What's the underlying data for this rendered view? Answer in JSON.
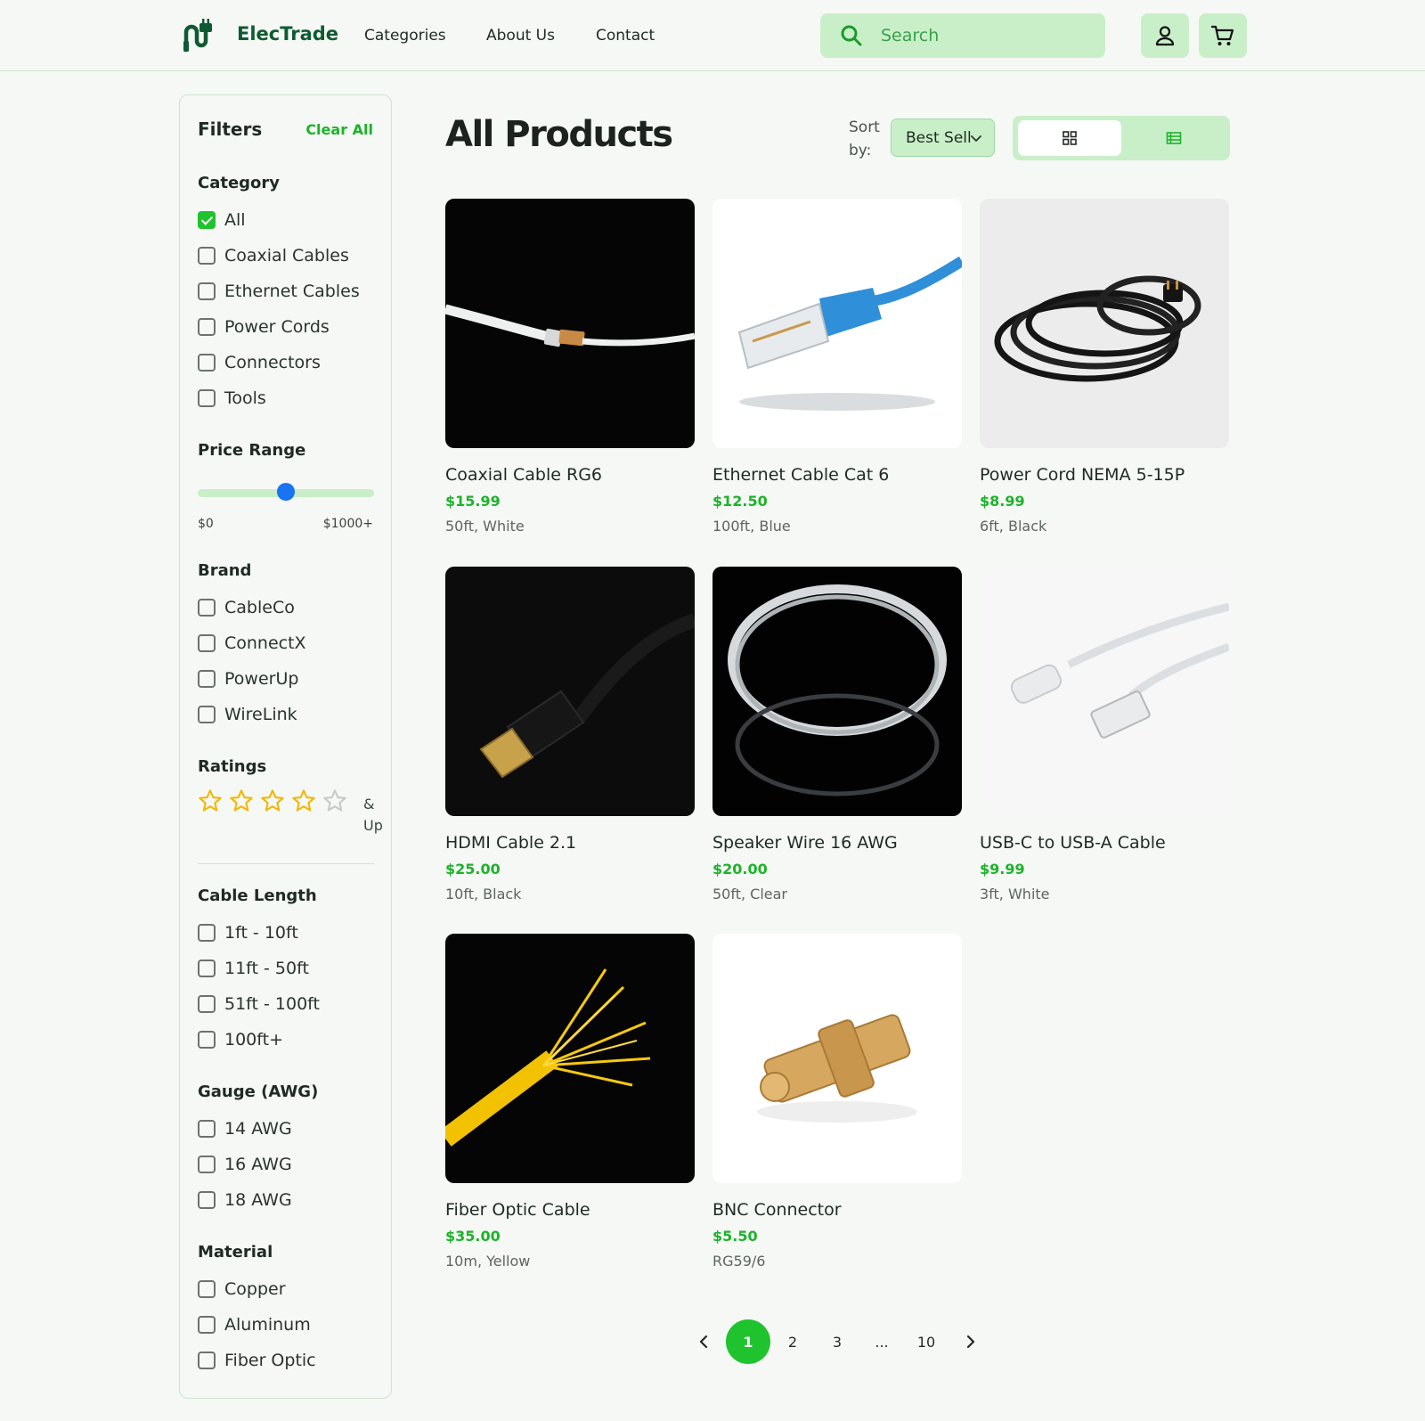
{
  "header": {
    "brand": "ElecTrade",
    "nav": [
      "Categories",
      "About Us",
      "Contact"
    ],
    "search_placeholder": "Search"
  },
  "sidebar": {
    "title": "Filters",
    "clear_all": "Clear All",
    "category": {
      "title": "Category",
      "items": [
        {
          "label": "All",
          "checked": true
        },
        {
          "label": "Coaxial Cables",
          "checked": false
        },
        {
          "label": "Ethernet Cables",
          "checked": false
        },
        {
          "label": "Power Cords",
          "checked": false
        },
        {
          "label": "Connectors",
          "checked": false
        },
        {
          "label": "Tools",
          "checked": false
        }
      ]
    },
    "price_range": {
      "title": "Price Range",
      "min_label": "$0",
      "max_label": "$1000+",
      "slider_fraction": 0.5
    },
    "brand": {
      "title": "Brand",
      "items": [
        "CableCo",
        "ConnectX",
        "PowerUp",
        "WireLink"
      ]
    },
    "ratings": {
      "title": "Ratings",
      "stars_selected": 4,
      "stars_total": 5,
      "suffix": "& Up"
    },
    "cable_length": {
      "title": "Cable Length",
      "items": [
        "1ft - 10ft",
        "11ft - 50ft",
        "51ft - 100ft",
        "100ft+"
      ]
    },
    "gauge": {
      "title": "Gauge (AWG)",
      "items": [
        "14 AWG",
        "16 AWG",
        "18 AWG"
      ]
    },
    "material": {
      "title": "Material",
      "items": [
        "Copper",
        "Aluminum",
        "Fiber Optic"
      ]
    }
  },
  "main": {
    "title": "All Products",
    "sort_label": "Sort by:",
    "sort_value": "Best Sellers",
    "view_mode": "grid",
    "products": [
      {
        "name": "Coaxial Cable RG6",
        "price": "$15.99",
        "spec": "50ft, White",
        "image": "coaxial-cable"
      },
      {
        "name": "Ethernet Cable Cat 6",
        "price": "$12.50",
        "spec": "100ft, Blue",
        "image": "ethernet-cable"
      },
      {
        "name": "Power Cord NEMA 5-15P",
        "price": "$8.99",
        "spec": "6ft, Black",
        "image": "power-cord"
      },
      {
        "name": "HDMI Cable 2.1",
        "price": "$25.00",
        "spec": "10ft, Black",
        "image": "hdmi-cable"
      },
      {
        "name": "Speaker Wire 16 AWG",
        "price": "$20.00",
        "spec": "50ft, Clear",
        "image": "speaker-wire"
      },
      {
        "name": "USB-C to USB-A Cable",
        "price": "$9.99",
        "spec": "3ft, White",
        "image": "usb-cable"
      },
      {
        "name": "Fiber Optic Cable",
        "price": "$35.00",
        "spec": "10m, Yellow",
        "image": "fiber-optic"
      },
      {
        "name": "BNC Connector",
        "price": "$5.50",
        "spec": "RG59/6",
        "image": "bnc-connector"
      }
    ]
  },
  "pagination": {
    "pages": [
      "1",
      "2",
      "3",
      "...",
      "10"
    ],
    "current": "1"
  },
  "colors": {
    "accent": "#1fc32e",
    "accent_light": "#c9efc9",
    "brand": "#0f5a32",
    "price": "#1db32a",
    "slider_thumb": "#1a73f0",
    "star": "#f2b705"
  }
}
